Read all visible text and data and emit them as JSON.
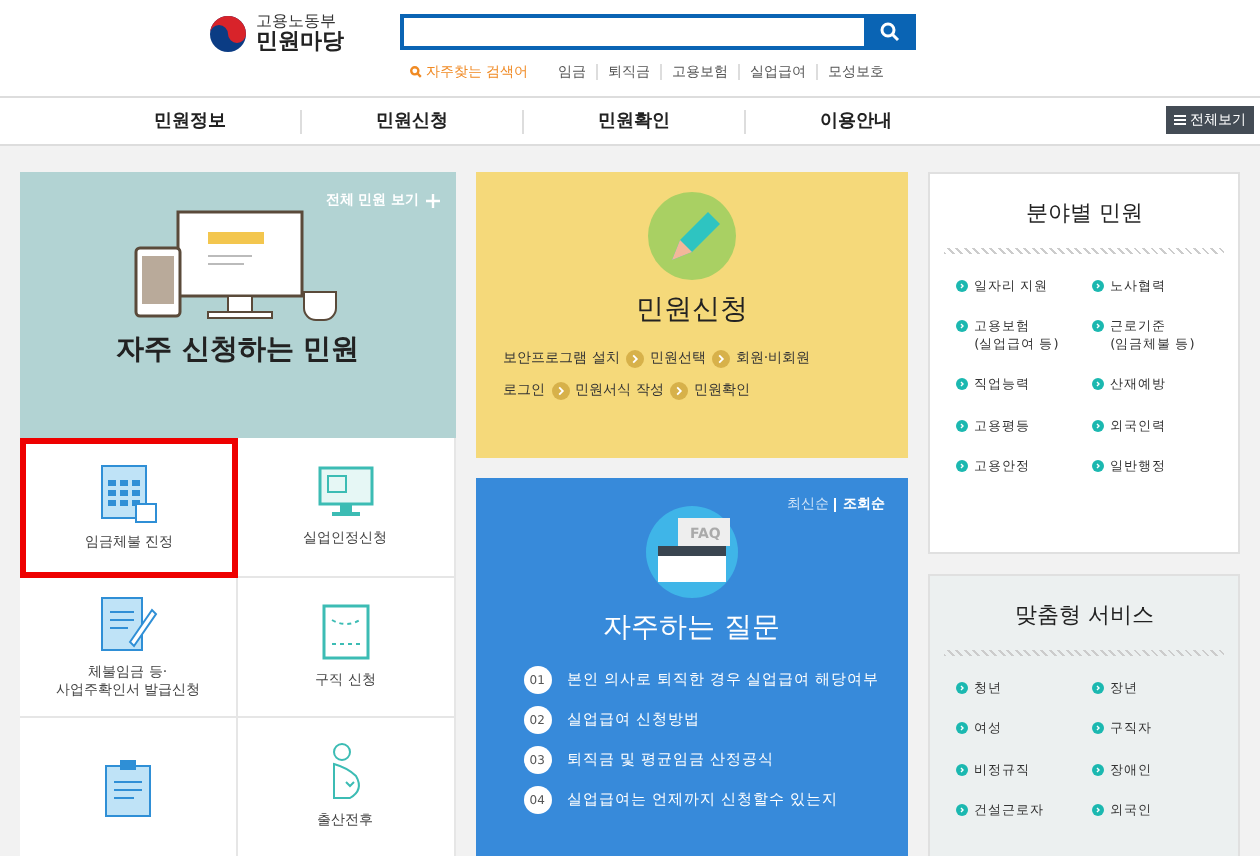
{
  "header": {
    "logo_top": "고용노동부",
    "logo_bottom": "민원마당",
    "popular_label": "자주찾는 검색어",
    "popular_terms": [
      "임금",
      "퇴직금",
      "고용보험",
      "실업급여",
      "모성보호"
    ]
  },
  "nav": {
    "items": [
      "민원정보",
      "민원신청",
      "민원확인",
      "이용안내"
    ],
    "all_menu": "전체보기"
  },
  "frequent": {
    "view_all": "전체 민원 보기",
    "title": "자주 신청하는 민원",
    "items": [
      {
        "kind": "calculator",
        "label": "임금체불 진정",
        "highlighted": true
      },
      {
        "kind": "monitor",
        "label": "실업인정신청",
        "highlighted": false
      },
      {
        "kind": "document",
        "label": "체불임금 등·\n사업주확인서 발급신청",
        "highlighted": false
      },
      {
        "kind": "frame",
        "label": "구직 신청",
        "highlighted": false
      },
      {
        "kind": "clipboard",
        "highlighted": false
      },
      {
        "kind": "pregnant",
        "label": "출산전후",
        "highlighted": false
      }
    ]
  },
  "apply": {
    "title": "민원신청",
    "steps_line1": [
      "보안프로그램 설치",
      "민원선택",
      "회원·비회원"
    ],
    "steps_line2": [
      "로그인",
      "민원서식 작성",
      "민원확인"
    ]
  },
  "faq": {
    "sort": [
      {
        "label": "최신순",
        "selected": false
      },
      {
        "label": "조회순",
        "selected": true
      }
    ],
    "badge": "FAQ",
    "title": "자주하는 질문",
    "items": [
      {
        "num": "01",
        "text": "본인 의사로 퇴직한 경우 실업급여 해당여부"
      },
      {
        "num": "02",
        "text": "실업급여 신청방법"
      },
      {
        "num": "03",
        "text": "퇴직금 및 평균임금 산정공식"
      },
      {
        "num": "04",
        "text": "실업급여는 언제까지 신청할수 있는지"
      }
    ]
  },
  "categories": {
    "title": "분야별 민원",
    "items": [
      "일자리 지원",
      "노사협력",
      "고용보험\n(실업급여 등)",
      "근로기준\n(임금체불 등)",
      "직업능력",
      "산재예방",
      "고용평등",
      "외국인력",
      "고용안정",
      "일반행정"
    ]
  },
  "custom": {
    "title": "맞춤형 서비스",
    "items": [
      "청년",
      "장년",
      "여성",
      "구직자",
      "비정규직",
      "장애인",
      "건설근로자",
      "외국인"
    ]
  }
}
